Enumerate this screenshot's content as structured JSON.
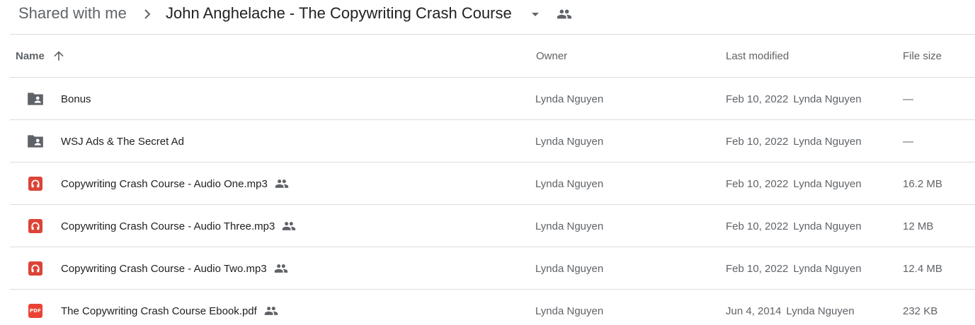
{
  "breadcrumb": {
    "root": "Shared with me",
    "current": "John Anghelache - The Copywriting Crash Course"
  },
  "columns": {
    "name": "Name",
    "owner": "Owner",
    "last_modified": "Last modified",
    "file_size": "File size"
  },
  "sort": {
    "column": "Name",
    "direction": "ascending"
  },
  "files": [
    {
      "name": "Bonus",
      "type": "shared-folder",
      "shared": false,
      "owner": "Lynda Nguyen",
      "modified_date": "Feb 10, 2022",
      "modified_by": "Lynda Nguyen",
      "size": "—"
    },
    {
      "name": "WSJ Ads & The Secret Ad",
      "type": "shared-folder",
      "shared": false,
      "owner": "Lynda Nguyen",
      "modified_date": "Feb 10, 2022",
      "modified_by": "Lynda Nguyen",
      "size": "—"
    },
    {
      "name": "Copywriting Crash Course - Audio One.mp3",
      "type": "audio",
      "shared": true,
      "owner": "Lynda Nguyen",
      "modified_date": "Feb 10, 2022",
      "modified_by": "Lynda Nguyen",
      "size": "16.2 MB"
    },
    {
      "name": "Copywriting Crash Course - Audio Three.mp3",
      "type": "audio",
      "shared": true,
      "owner": "Lynda Nguyen",
      "modified_date": "Feb 10, 2022",
      "modified_by": "Lynda Nguyen",
      "size": "12 MB"
    },
    {
      "name": "Copywriting Crash Course - Audio Two.mp3",
      "type": "audio",
      "shared": true,
      "owner": "Lynda Nguyen",
      "modified_date": "Feb 10, 2022",
      "modified_by": "Lynda Nguyen",
      "size": "12.4 MB"
    },
    {
      "name": "The Copywriting Crash Course Ebook.pdf",
      "type": "pdf",
      "shared": true,
      "owner": "Lynda Nguyen",
      "modified_date": "Jun 4, 2014",
      "modified_by": "Lynda Nguyen",
      "size": "232 KB"
    }
  ],
  "icons": {
    "folder_color": "#5f6368",
    "audio_color": "#db4437",
    "pdf_color": "#ea4335",
    "pdf_label": "PDF"
  }
}
